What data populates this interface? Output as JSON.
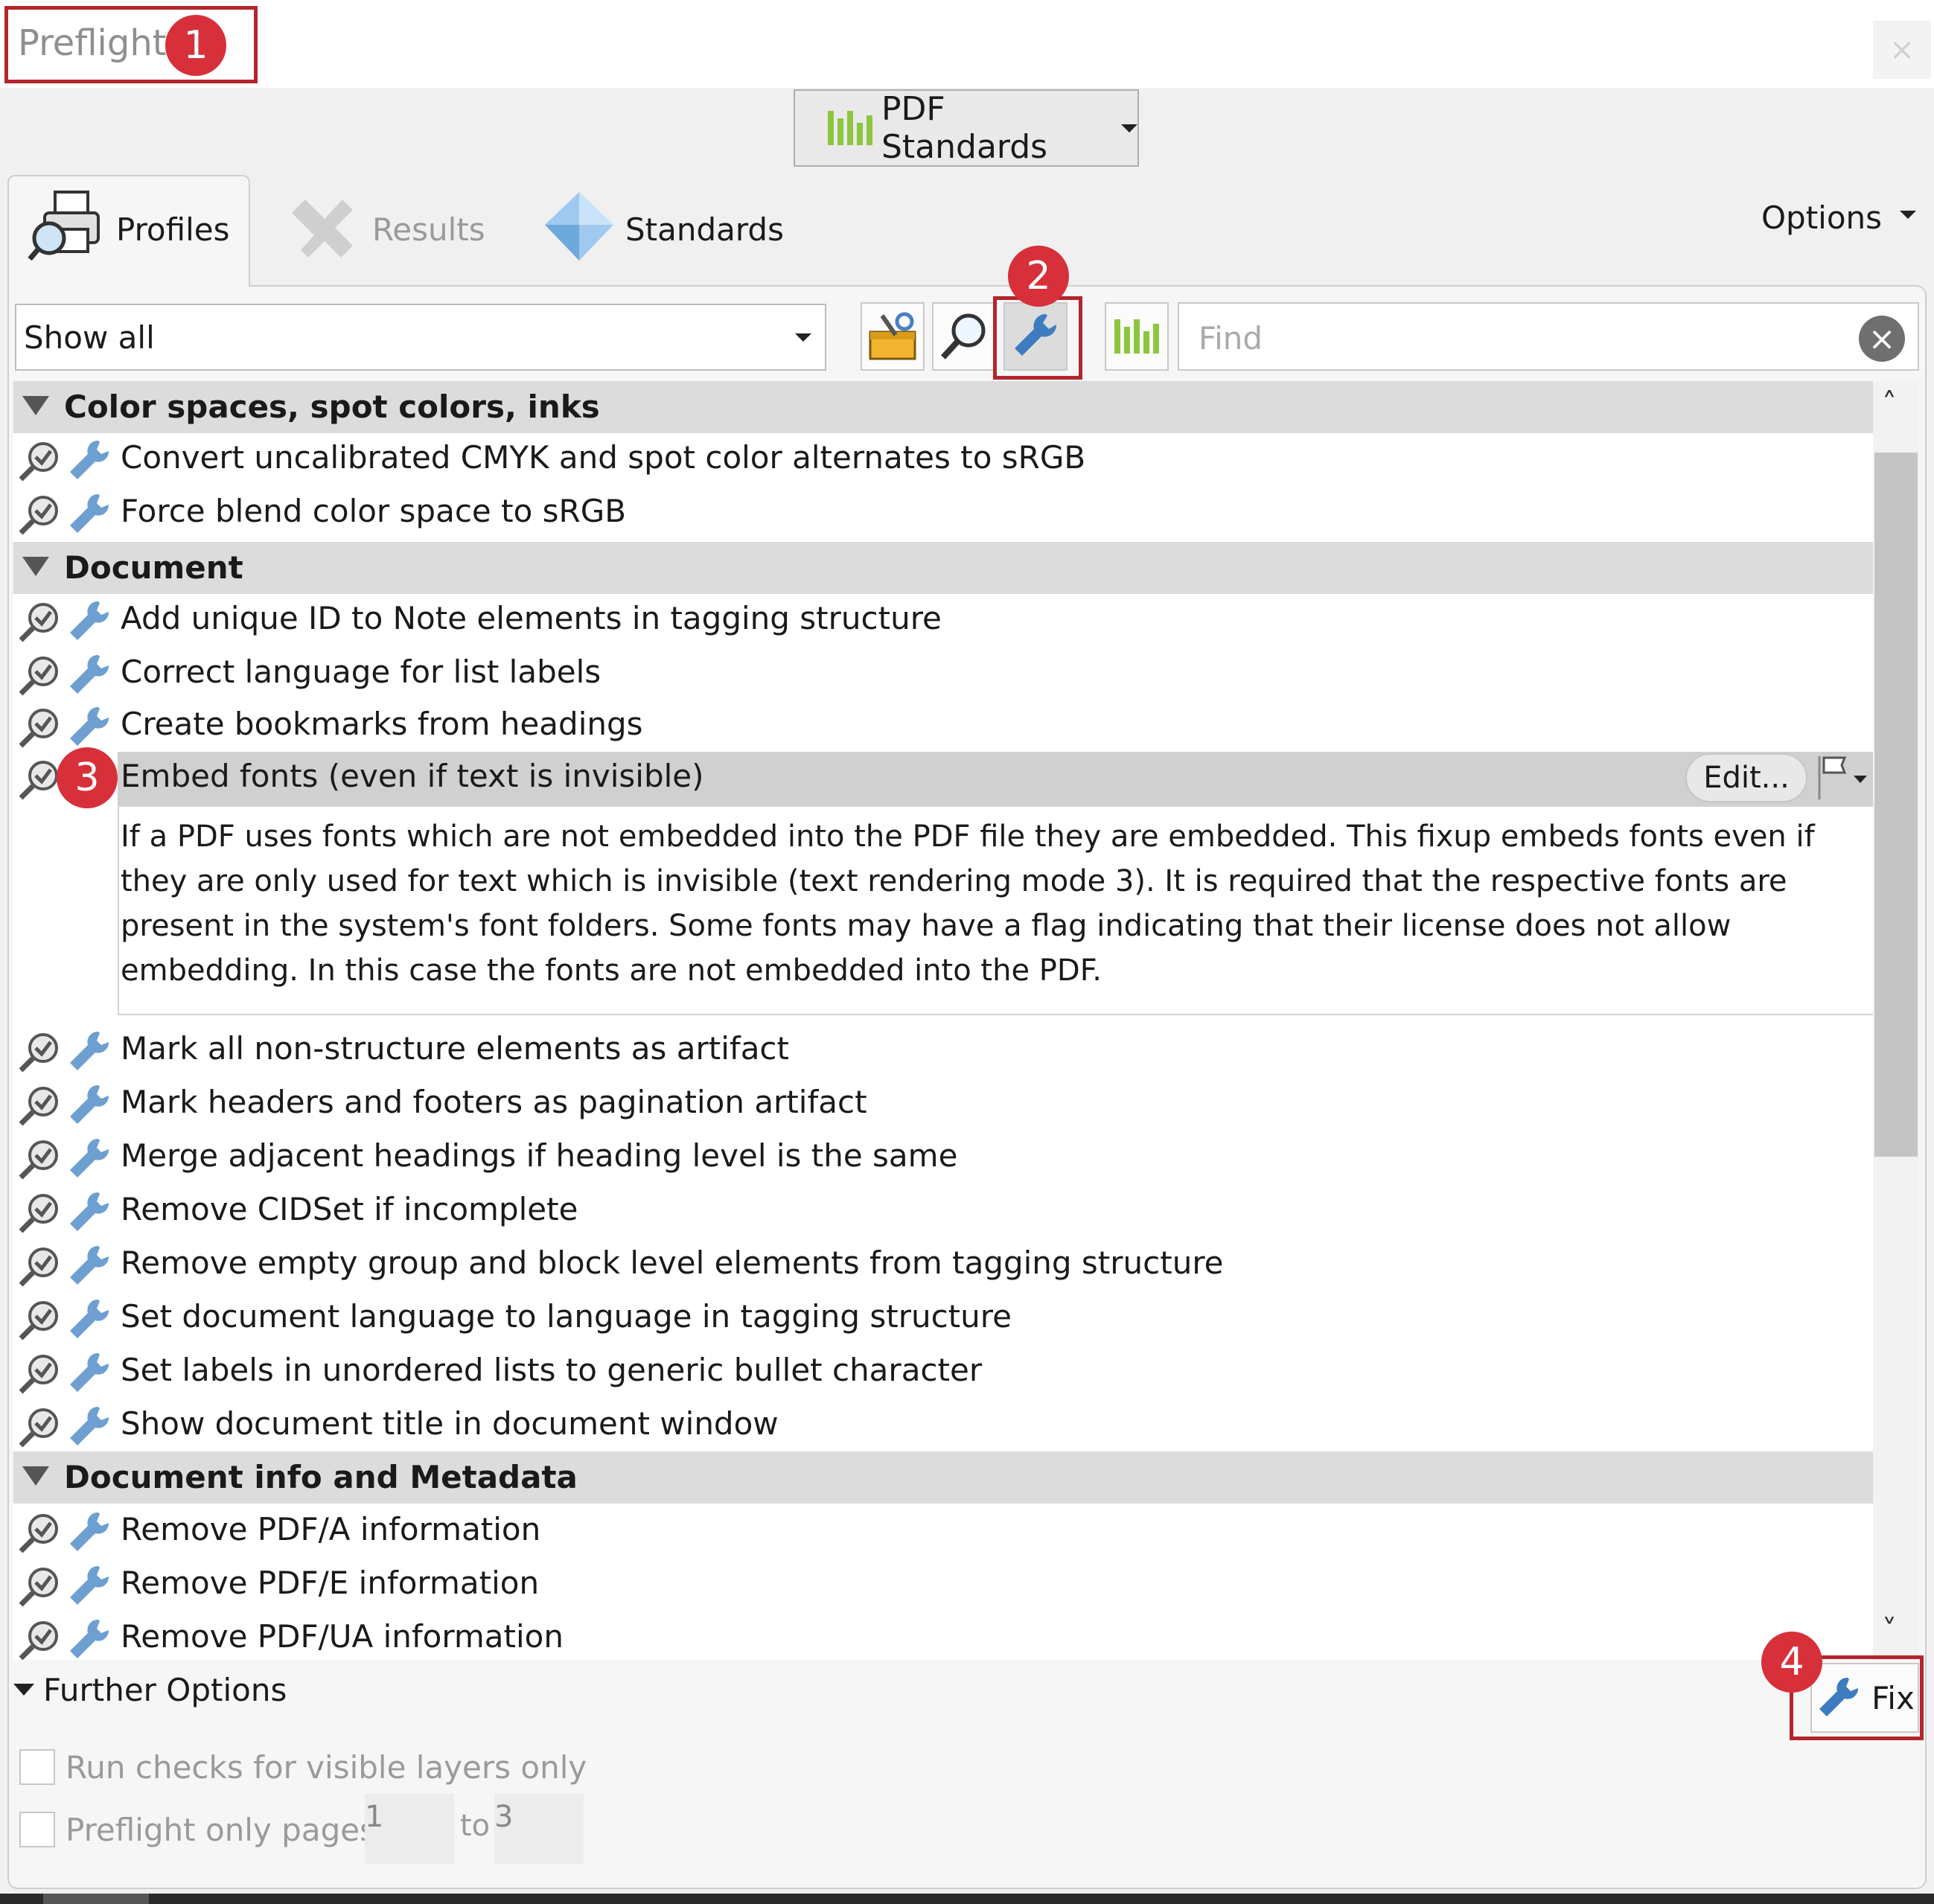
{
  "window": {
    "title": "Preflight",
    "close_symbol": "×"
  },
  "annotations": {
    "badge_1": "1",
    "badge_2": "2",
    "badge_3": "3",
    "badge_4": "4",
    "highlight_color": "#b3262b",
    "badge_color": "#d7303a"
  },
  "standards_dropdown": {
    "label": "PDF Standards",
    "icon": "bars-chart-icon"
  },
  "tabs": [
    {
      "label": "Profiles",
      "icon": "printer-magnifier-icon",
      "active": true
    },
    {
      "label": "Results",
      "icon": "results-x-icon",
      "active": false
    },
    {
      "label": "Standards",
      "icon": "diamond-icon",
      "active": false
    }
  ],
  "options": {
    "label": "Options"
  },
  "toolbar": {
    "filter_value": "Show all",
    "buttons": [
      "profiles-toolbox-icon",
      "checks-magnifier-icon",
      "fixups-wrench-icon",
      "standards-bars-icon"
    ],
    "find_placeholder": "Find"
  },
  "list": {
    "groups": [
      {
        "name": "Color spaces, spot colors, inks",
        "items": [
          "Convert uncalibrated CMYK and spot color alternates to sRGB",
          "Force blend color space to sRGB"
        ]
      },
      {
        "name": "Document",
        "items": [
          "Add unique ID to Note elements in tagging structure",
          "Correct language for list labels",
          "Create bookmarks from headings",
          "Embed fonts (even if text is invisible)",
          "Mark all non-structure elements as artifact",
          "Mark headers and footers as pagination artifact",
          "Merge adjacent headings if heading level is the same",
          "Remove CIDSet if incomplete",
          "Remove empty group and block level elements from tagging structure",
          "Set document language to language in tagging structure",
          "Set labels in unordered lists to generic bullet character",
          "Show document title in document window"
        ]
      },
      {
        "name": "Document info and Metadata",
        "items": [
          "Remove PDF/A information",
          "Remove PDF/E information",
          "Remove PDF/UA information"
        ]
      }
    ],
    "selected": {
      "label": "Embed fonts (even if text is invisible)",
      "description": "If a PDF uses fonts which are not embedded into the PDF file they are embedded. This fixup embeds fonts even if they are only used for text which is invisible (text rendering mode 3). It is required that the respective fonts are present in the system's font folders. Some fonts may have a flag indicating that their license does not allow embedding. In this case the fonts are not embedded into the PDF.",
      "edit_label": "Edit..."
    }
  },
  "further_options": {
    "label": "Further Options",
    "visible_layers_label": "Run checks for visible layers only",
    "pages_label": "Preflight only pages",
    "from_page": "1",
    "to_label": "to",
    "to_page": "3"
  },
  "fix_button": {
    "label": "Fix",
    "icon": "wrench-icon"
  }
}
